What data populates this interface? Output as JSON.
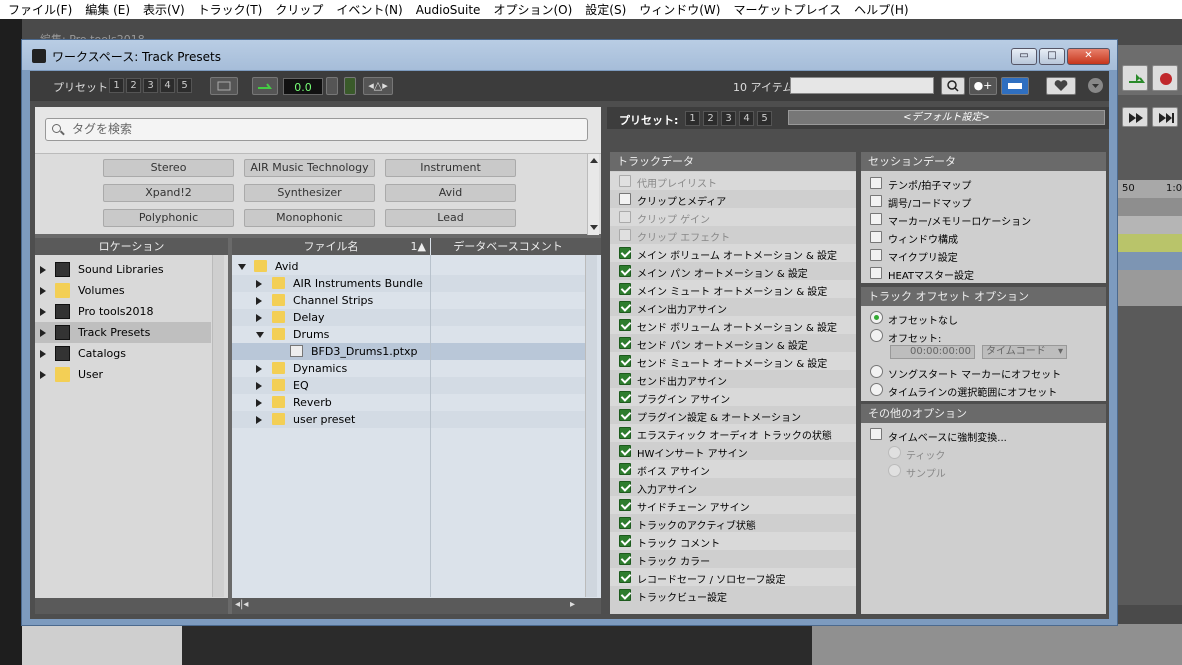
{
  "menubar": [
    "ファイル(F)",
    "編集 (E)",
    "表示(V)",
    "トラック(T)",
    "クリップ",
    "イベント(N)",
    "AudioSuite",
    "オプション(O)",
    "設定(S)",
    "ウィンドウ(W)",
    "マーケットプレイス",
    "ヘルプ(H)"
  ],
  "background": {
    "faint_title": "編集: Pro tools2018",
    "ruler_marks": [
      "50",
      "1:0"
    ]
  },
  "window": {
    "title": "ワークスペース: Track Presets",
    "buttons": {
      "minimize": "▭",
      "maximize": "□",
      "close": "✕"
    }
  },
  "toolbar": {
    "preset_label": "プリセット:",
    "preset_numbers": [
      "1",
      "2",
      "3",
      "4",
      "5"
    ],
    "counter": "0.0",
    "item_count": "10 アイテム",
    "search_value": ""
  },
  "tags": {
    "search_placeholder": "タグを検索",
    "items": [
      "Stereo",
      "AIR Music Technology",
      "Instrument",
      "Xpand!2",
      "Synthesizer",
      "Avid",
      "Polyphonic",
      "Monophonic",
      "Lead"
    ]
  },
  "locations": {
    "header": "ロケーション",
    "items": [
      {
        "label": "Sound Libraries",
        "icon": "sound-library-icon",
        "selected": false
      },
      {
        "label": "Volumes",
        "icon": "folder-icon",
        "selected": false
      },
      {
        "label": "Pro tools2018",
        "icon": "session-icon",
        "selected": false
      },
      {
        "label": "Track Presets",
        "icon": "track-presets-icon",
        "selected": true
      },
      {
        "label": "Catalogs",
        "icon": "catalog-icon",
        "selected": false
      },
      {
        "label": "User",
        "icon": "folder-icon",
        "selected": false
      }
    ]
  },
  "files": {
    "header_name": "ファイル名",
    "header_sort": "1▲",
    "header_comment": "データベースコメント",
    "items": [
      {
        "label": "Avid",
        "level": 0,
        "type": "folder",
        "expanded": true
      },
      {
        "label": "AIR Instruments Bundle",
        "level": 1,
        "type": "folder",
        "expanded": false
      },
      {
        "label": "Channel Strips",
        "level": 1,
        "type": "folder",
        "expanded": false
      },
      {
        "label": "Delay",
        "level": 1,
        "type": "folder",
        "expanded": false
      },
      {
        "label": "Drums",
        "level": 1,
        "type": "folder",
        "expanded": true
      },
      {
        "label": "BFD3_Drums1.ptxp",
        "level": 2,
        "type": "file",
        "selected": true
      },
      {
        "label": "Dynamics",
        "level": 1,
        "type": "folder",
        "expanded": false
      },
      {
        "label": "EQ",
        "level": 1,
        "type": "folder",
        "expanded": false
      },
      {
        "label": "Reverb",
        "level": 1,
        "type": "folder",
        "expanded": false
      },
      {
        "label": "user preset",
        "level": 1,
        "type": "folder",
        "expanded": false
      }
    ]
  },
  "right": {
    "preset_label": "プリセット:",
    "preset_numbers": [
      "1",
      "2",
      "3",
      "4",
      "5"
    ],
    "default_setting": "<デフォルト設定>",
    "track_data": {
      "title": "トラックデータ",
      "items": [
        {
          "label": "代用プレイリスト",
          "state": "disabled"
        },
        {
          "label": "クリップとメディア",
          "state": "off"
        },
        {
          "label": "クリップ ゲイン",
          "state": "disabled"
        },
        {
          "label": "クリップ エフェクト",
          "state": "disabled"
        },
        {
          "label": "メイン ボリューム オートメーション & 設定",
          "state": "on"
        },
        {
          "label": "メイン パン オートメーション & 設定",
          "state": "on"
        },
        {
          "label": "メイン ミュート オートメーション & 設定",
          "state": "on"
        },
        {
          "label": "メイン出力アサイン",
          "state": "on"
        },
        {
          "label": "センド ボリューム オートメーション & 設定",
          "state": "on"
        },
        {
          "label": "センド パン オートメーション & 設定",
          "state": "on"
        },
        {
          "label": "センド ミュート オートメーション & 設定",
          "state": "on"
        },
        {
          "label": "センド出力アサイン",
          "state": "on"
        },
        {
          "label": "プラグイン アサイン",
          "state": "on"
        },
        {
          "label": "プラグイン設定 & オートメーション",
          "state": "on"
        },
        {
          "label": "エラスティック オーディオ トラックの状態",
          "state": "on"
        },
        {
          "label": "HWインサート アサイン",
          "state": "on"
        },
        {
          "label": "ボイス アサイン",
          "state": "on"
        },
        {
          "label": "入力アサイン",
          "state": "on"
        },
        {
          "label": "サイドチェーン アサイン",
          "state": "on"
        },
        {
          "label": "トラックのアクティブ状態",
          "state": "on"
        },
        {
          "label": "トラック コメント",
          "state": "on"
        },
        {
          "label": "トラック カラー",
          "state": "on"
        },
        {
          "label": "レコードセーフ / ソロセーフ設定",
          "state": "on"
        },
        {
          "label": "トラックビュー設定",
          "state": "on"
        }
      ]
    },
    "session_data": {
      "title": "セッションデータ",
      "items": [
        "テンポ/拍子マップ",
        "調号/コードマップ",
        "マーカー/メモリーロケーション",
        "ウィンドウ構成",
        "マイクプリ設定",
        "HEATマスター設定"
      ]
    },
    "offset": {
      "title": "トラック オフセット オプション",
      "none": "オフセットなし",
      "offset": "オフセット:",
      "timecode_value": "00:00:00:00",
      "timecode_unit": "タイムコード",
      "song_start": "ソングスタート マーカーにオフセット",
      "timeline_sel": "タイムラインの選択範囲にオフセット"
    },
    "other": {
      "title": "その他のオプション",
      "force": "タイムベースに強制変換...",
      "tick": "ティック",
      "sample": "サンプル"
    }
  },
  "colors": {
    "accent_green": "#2e7d2e",
    "selection": "#b9c7d8",
    "window_chrome": "#7d9bbf"
  }
}
